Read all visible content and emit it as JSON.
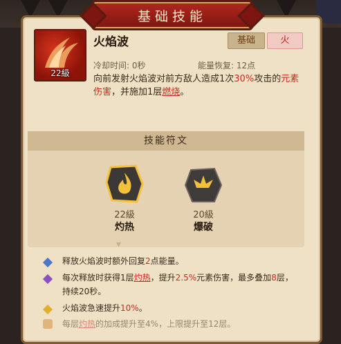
{
  "title": "基础技能",
  "skill": {
    "name": "火焰波",
    "level": "22級",
    "tags": [
      "基础",
      "火"
    ],
    "cooldown": "冷却时间: 0秒",
    "energy": "能量恢复: 12点",
    "description": {
      "p1": "向前发射火焰波对前方敌人造成1次",
      "percent": "30%",
      "p2": "攻击的",
      "element": "元素伤害",
      "p3": "，并施加1层",
      "burn": "燃烧",
      "p4": "。"
    }
  },
  "runes": {
    "header": "技能符文",
    "items": [
      {
        "level": "22級",
        "name": "灼热",
        "icon": "flame-icon"
      },
      {
        "level": "20級",
        "name": "爆破",
        "icon": "burst-icon"
      }
    ]
  },
  "effects": [
    {
      "icon": "blue-diamond-icon",
      "color": "#4a78c8",
      "parts": [
        "释放火焰波时额外回复",
        "2",
        "点能量。"
      ]
    },
    {
      "icon": "purple-diamond-icon",
      "color": "#8a4fc0",
      "parts": [
        "每次释放时获得1层",
        "灼热",
        "，提升",
        "2.5%",
        "元素伤害，最多叠加",
        "8",
        "层，持续20秒。"
      ]
    },
    {
      "icon": "yellow-diamond-icon",
      "color": "#e0b030",
      "parts": [
        "火焰波急速提升",
        "10%",
        "。"
      ]
    },
    {
      "icon": "lock-icon",
      "color": "#d08a30",
      "parts": [
        "每层",
        "灼热",
        "的加成提升至4%，上限提升至12层。"
      ]
    }
  ],
  "colors": {
    "accent_red": "#c72a20",
    "banner": "#b2281f",
    "panel": "#efe1c6"
  }
}
